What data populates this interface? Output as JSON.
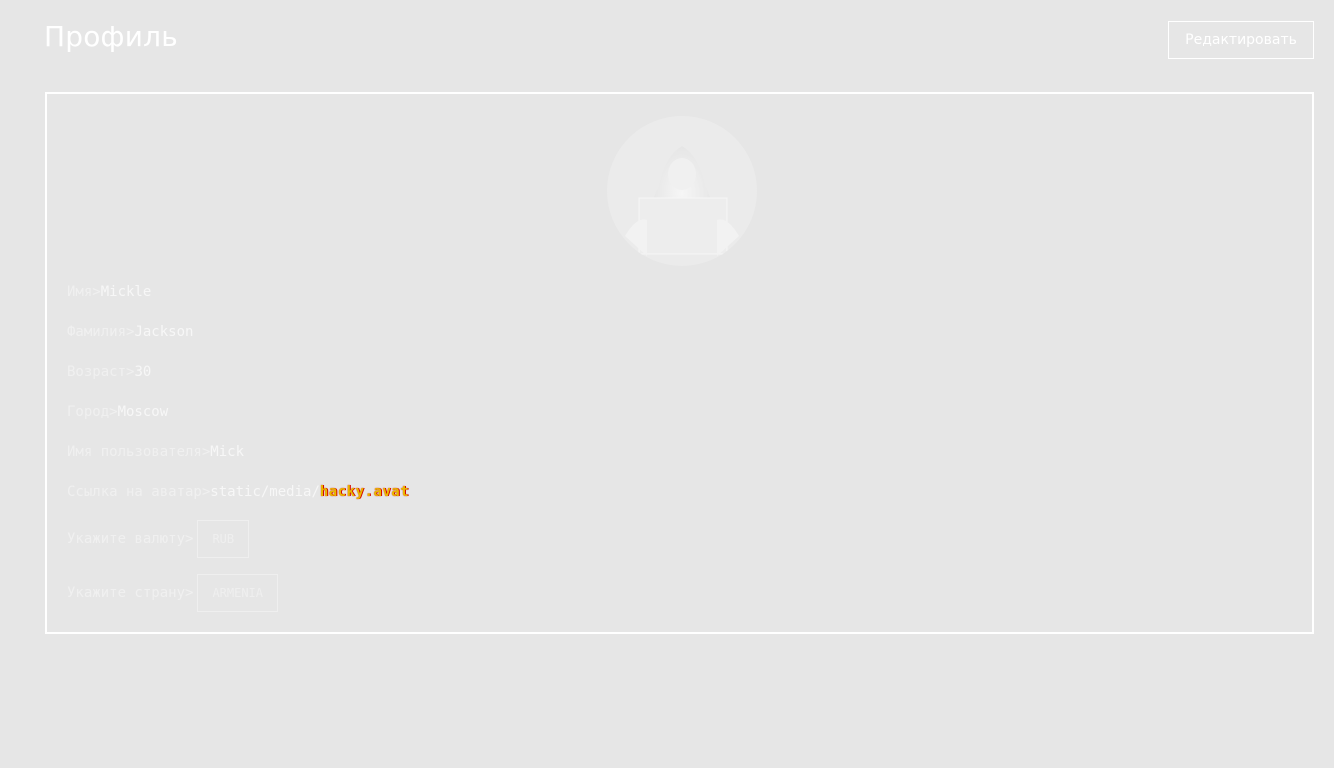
{
  "header": {
    "title": "Профиль",
    "edit_label": "Редактировать"
  },
  "profile": {
    "first_name": {
      "label": "Имя> ",
      "value": "Mickle"
    },
    "last_name": {
      "label": "Фамилия> ",
      "value": "Jackson"
    },
    "age": {
      "label": "Возраст> ",
      "value": "30"
    },
    "city": {
      "label": "Город> ",
      "value": "Moscow"
    },
    "username": {
      "label": "Имя пользователя> ",
      "value": "Mick"
    },
    "avatar_link": {
      "label": "Ссылка на аватар> ",
      "value": "static/media/",
      "file": "hacky.avat"
    },
    "currency": {
      "label": "Укажите валюту> ",
      "selected": "RUB"
    },
    "country": {
      "label": "Укажите страну> ",
      "selected": "ARMENIA"
    }
  },
  "icons": {
    "avatar": "user-avatar-image"
  },
  "colors": {
    "background": "#e6e6e6",
    "foreground": "#ffffff",
    "avatar_file_text": "#e8b800",
    "avatar_file_outline": "#d40000"
  }
}
